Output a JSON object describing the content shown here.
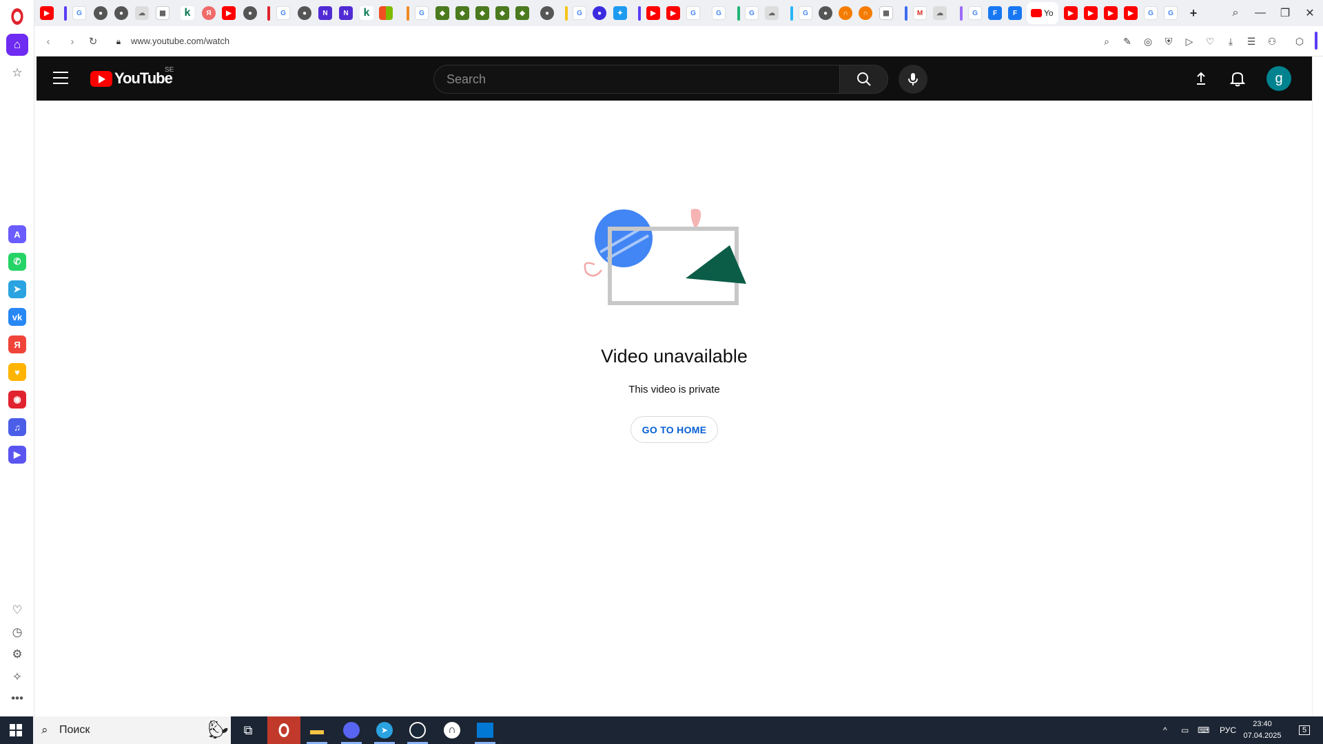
{
  "browser": {
    "address_url": "www.youtube.com/watch",
    "active_tab_label": "Yo",
    "sidebar_apps": [
      "aria-icon",
      "whatsapp-icon",
      "telegram-icon",
      "vk-icon",
      "yandex-icon",
      "chat-icon",
      "gaming-icon",
      "music-icon",
      "player-icon"
    ]
  },
  "youtube": {
    "logo_text": "YouTube",
    "country_code": "SE",
    "search_placeholder": "Search",
    "avatar_letter": "g"
  },
  "error": {
    "title": "Video unavailable",
    "message": "This video is private",
    "home_button": "GO TO HOME"
  },
  "taskbar": {
    "search_placeholder": "Поиск",
    "language": "РУС",
    "time": "23:40",
    "date": "07.04.2025",
    "notification_count": "5"
  },
  "colors": {
    "opera_red": "#e0232e",
    "opera_purple": "#6e2bf2",
    "youtube_red": "#ff0000",
    "link_blue": "#065fd4",
    "avatar_teal": "#00838f"
  }
}
